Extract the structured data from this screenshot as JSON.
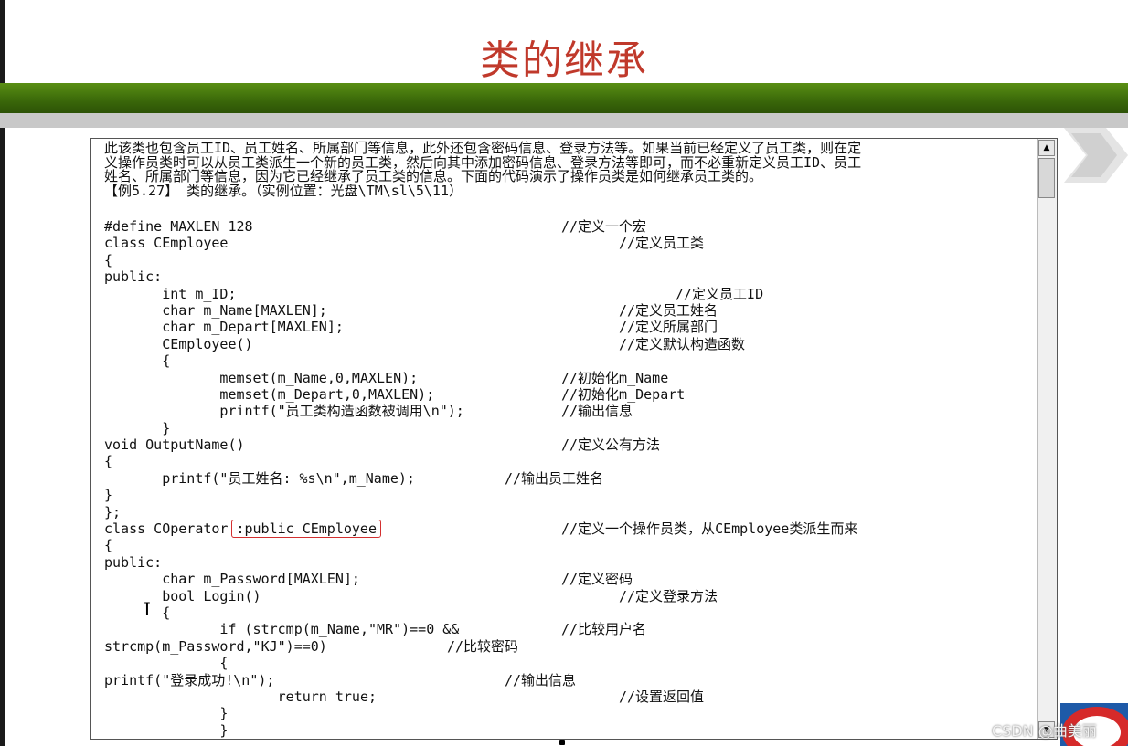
{
  "slide": {
    "title": "类的继承"
  },
  "intro": [
    "此该类也包含员工ID、员工姓名、所属部门等信息，此外还包含密码信息、登录方法等。如果当前已经定义了员工类，则在定",
    "义操作员类时可以从员工类派生一个新的员工类，然后向其中添加密码信息、登录方法等即可，而不必重新定义员工ID、员工",
    "姓名、所属部门等信息，因为它已经继承了员工类的信息。下面的代码演示了操作员类是如何继承员工类的。",
    "【例5.27】 类的继承。（实例位置：光盘\\TM\\sl\\5\\11）"
  ],
  "code": [
    {
      "text": "#define MAXLEN 128",
      "comment": "//定义一个宏",
      "col": 500
    },
    {
      "text": "class CEmployee",
      "comment": "//定义员工类",
      "col": 563
    },
    {
      "text": "{",
      "comment": "",
      "col": 0
    },
    {
      "text": "public:",
      "comment": "",
      "col": 0
    },
    {
      "text": "       int m_ID;",
      "comment": "//定义员工ID",
      "col": 625
    },
    {
      "text": "       char m_Name[MAXLEN];",
      "comment": "//定义员工姓名",
      "col": 563
    },
    {
      "text": "       char m_Depart[MAXLEN];",
      "comment": "//定义所属部门",
      "col": 563
    },
    {
      "text": "       CEmployee()",
      "comment": "//定义默认构造函数",
      "col": 563
    },
    {
      "text": "       {",
      "comment": "",
      "col": 0
    },
    {
      "text": "              memset(m_Name,0,MAXLEN);",
      "comment": "//初始化m_Name",
      "col": 500
    },
    {
      "text": "              memset(m_Depart,0,MAXLEN);",
      "comment": "//初始化m_Depart",
      "col": 500
    },
    {
      "text": "              printf(\"员工类构造函数被调用\\n\");",
      "comment": "//输出信息",
      "col": 500
    },
    {
      "text": "       }",
      "comment": "",
      "col": 0
    },
    {
      "text": "void OutputName()",
      "comment": "//定义公有方法",
      "col": 500
    },
    {
      "text": "{",
      "comment": "",
      "col": 0
    },
    {
      "text": "       printf(\"员工姓名: %s\\n\",m_Name);",
      "comment": "//输出员工姓名",
      "col": 438
    },
    {
      "text": "}",
      "comment": "",
      "col": 0
    },
    {
      "text": "};",
      "comment": "",
      "col": 0
    },
    {
      "text": "class COperator",
      "highlight": ":public CEmployee",
      "comment": "//定义一个操作员类，从CEmployee类派生而来",
      "col": 500
    },
    {
      "text": "{",
      "comment": "",
      "col": 0
    },
    {
      "text": "public:",
      "comment": "",
      "col": 0
    },
    {
      "text": "       char m_Password[MAXLEN];",
      "comment": "//定义密码",
      "col": 500
    },
    {
      "text": "       bool Login()",
      "comment": "//定义登录方法",
      "col": 563
    },
    {
      "text": "       {",
      "comment": "",
      "col": 0
    },
    {
      "text": "              if (strcmp(m_Name,\"MR\")==0 &&",
      "comment": "//比较用户名",
      "col": 500
    },
    {
      "text": "strcmp(m_Password,\"KJ\")==0)",
      "comment": "//比较密码",
      "col": 375
    },
    {
      "text": "              {",
      "comment": "",
      "col": 0
    },
    {
      "text": "printf(\"登录成功!\\n\");",
      "comment": "//输出信息",
      "col": 438
    },
    {
      "text": "                     return true;",
      "comment": "//设置返回值",
      "col": 563
    },
    {
      "text": "              }",
      "comment": "",
      "col": 0
    },
    {
      "text": "              }",
      "comment": "",
      "col": 0
    }
  ],
  "watermark": "CSDN @曲美丽",
  "colors": {
    "title": "#c0392b",
    "band": "#3c6a0a",
    "highlight_border": "#d32f2f"
  }
}
